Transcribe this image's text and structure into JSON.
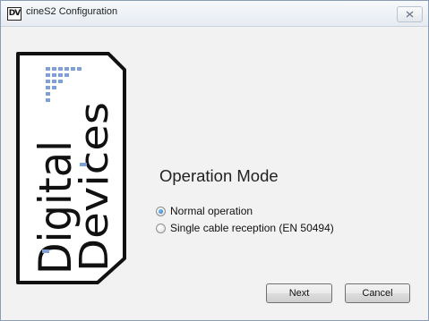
{
  "window": {
    "title": "cineS2 Configuration",
    "app_icon": "DV"
  },
  "logo": {
    "icon": "digital-devices-logo",
    "line1": "Digital",
    "line2": "Devices",
    "accent_color": "#7f9fd7"
  },
  "main": {
    "heading": "Operation Mode",
    "options": [
      {
        "label": "Normal operation",
        "selected": true
      },
      {
        "label": "Single cable reception (EN 50494)",
        "selected": false
      }
    ]
  },
  "buttons": {
    "next_label": "Next",
    "cancel_label": "Cancel"
  }
}
